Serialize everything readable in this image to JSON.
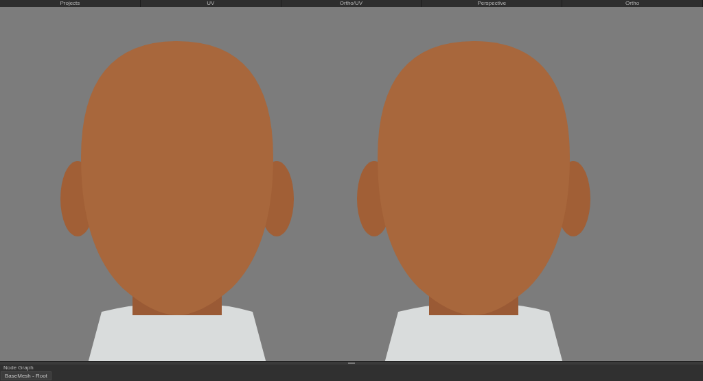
{
  "view_tabs": [
    {
      "label": "Projects"
    },
    {
      "label": "UV"
    },
    {
      "label": "Ortho/UV"
    },
    {
      "label": "Perspective"
    },
    {
      "label": "Ortho"
    }
  ],
  "viewport": {
    "models": [
      {
        "kind": "head"
      },
      {
        "kind": "head"
      }
    ]
  },
  "bottom_panel": {
    "title": "Node Graph",
    "tabs": [
      {
        "label": "BaseMesh - Root"
      }
    ]
  }
}
